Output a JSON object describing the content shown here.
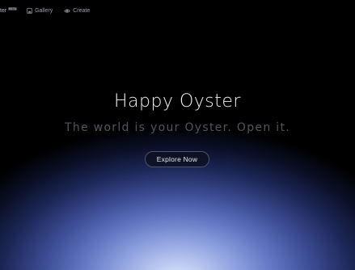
{
  "nav": {
    "brand": "ter",
    "brand_badge": "BETA",
    "items": [
      {
        "label": "Gallery",
        "icon": "image-icon"
      },
      {
        "label": "Create",
        "icon": "eye-icon"
      }
    ]
  },
  "hero": {
    "title": "Happy Oyster",
    "subtitle": "The world is your Oyster. Open it.",
    "cta_label": "Explore Now"
  },
  "colors": {
    "background": "#000000",
    "glow_center": "#dde5fb",
    "glow_mid": "#6276c3",
    "subtitle": "#51555e"
  }
}
